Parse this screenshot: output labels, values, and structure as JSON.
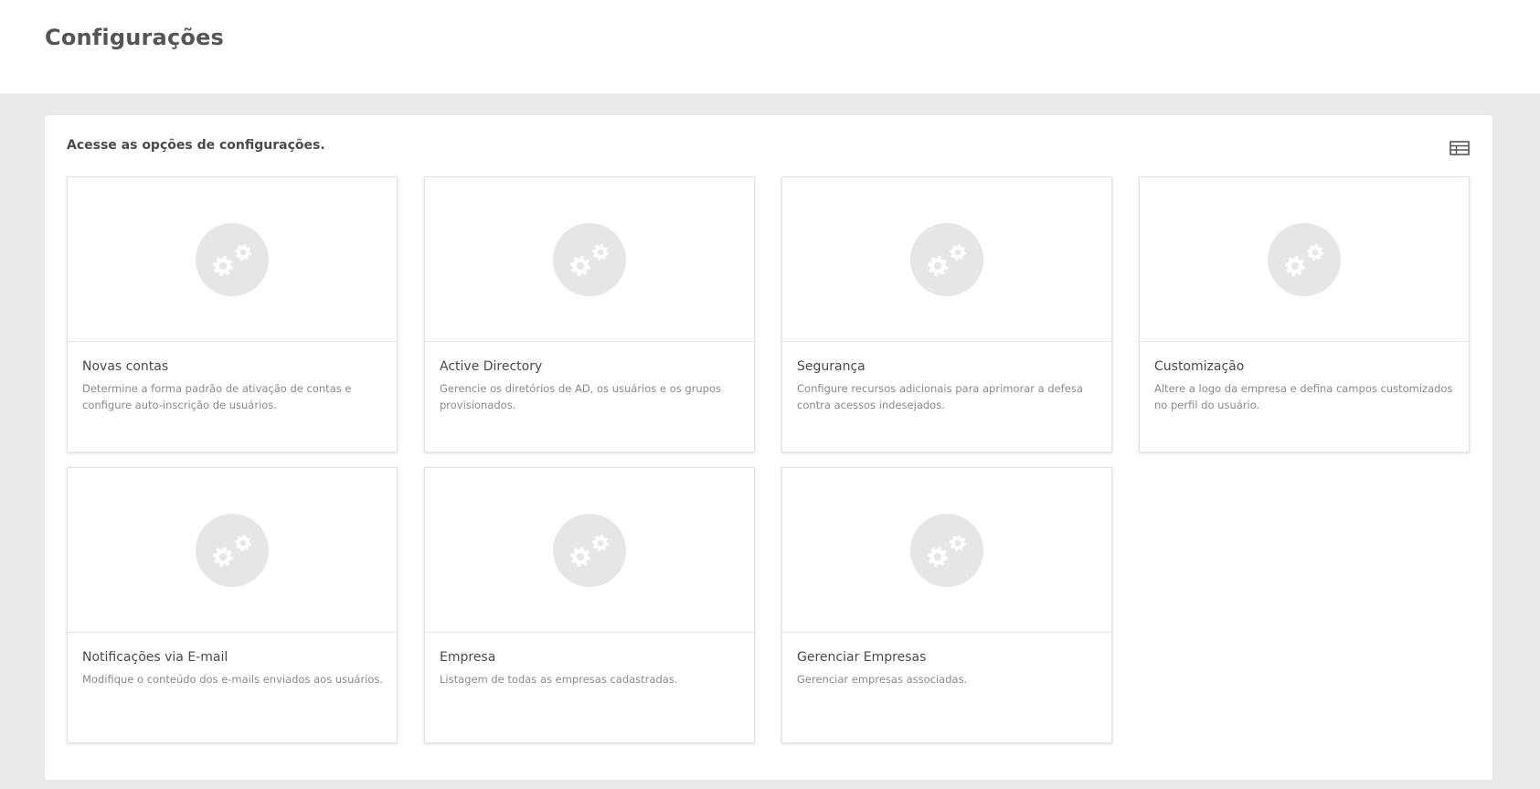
{
  "page": {
    "title": "Configurações"
  },
  "panel": {
    "subtitle": "Acesse as opções de configurações.",
    "view_toggle_icon": "table-view-icon"
  },
  "cards": [
    {
      "title": "Novas contas",
      "description": "Determine a forma padrão de ativação de contas e configure auto-inscrição de usuários.",
      "icon": "gears-icon"
    },
    {
      "title": "Active Directory",
      "description": "Gerencie os diretórios de AD, os usuários e os grupos provisionados.",
      "icon": "gears-icon"
    },
    {
      "title": "Segurança",
      "description": "Configure recursos adicionais para aprimorar a defesa contra acessos indesejados.",
      "icon": "gears-icon"
    },
    {
      "title": "Customização",
      "description": "Altere a logo da empresa e defina campos customizados no perfil do usuário.",
      "icon": "gears-icon"
    },
    {
      "title": "Notificações via E-mail",
      "description": "Modifique o conteúdo dos e-mails enviados aos usuários.",
      "icon": "gears-icon"
    },
    {
      "title": "Empresa",
      "description": "Listagem de todas as empresas cadastradas.",
      "icon": "gears-icon"
    },
    {
      "title": "Gerenciar Empresas",
      "description": "Gerenciar empresas associadas.",
      "icon": "gears-icon"
    }
  ],
  "colors": {
    "background": "#e8e9ea",
    "surface": "#ffffff",
    "icon_circle": "#e6e6e6",
    "icon_gear": "#ffffff"
  }
}
